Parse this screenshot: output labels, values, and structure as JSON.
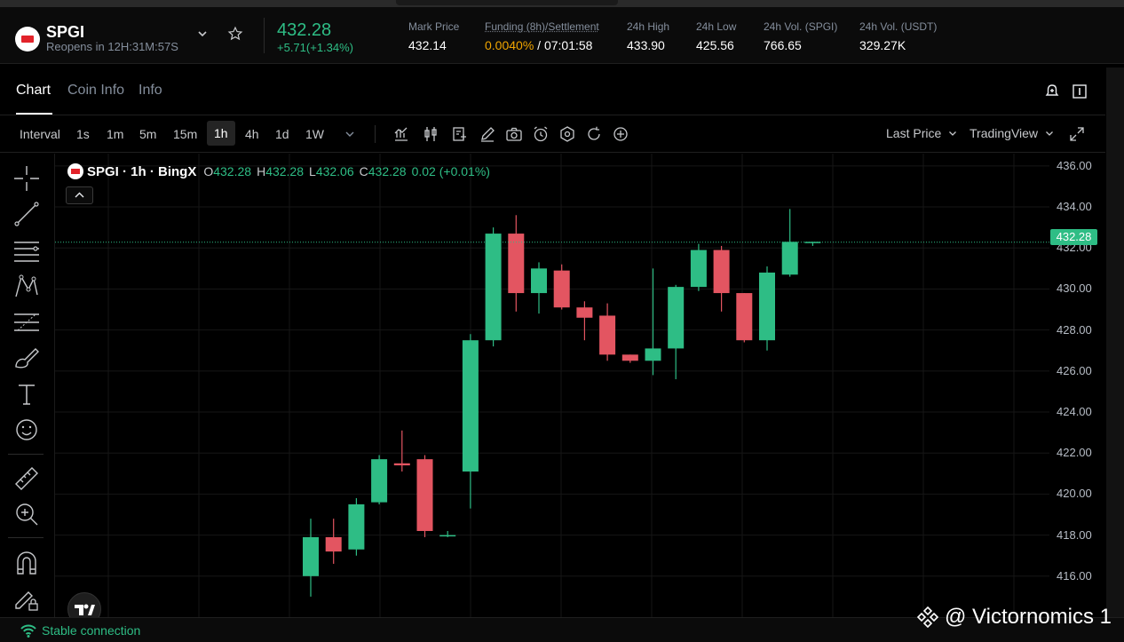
{
  "header": {
    "symbol": "SPGI",
    "reopen_text": "Reopens in  12H:31M:57S",
    "last_price": "432.28",
    "change": "+5.71(+1.34%)",
    "stats": [
      {
        "label": "Mark Price",
        "value": "432.14"
      },
      {
        "label": "Funding (8h)/Settlement",
        "rate": "0.0040%",
        "settle": " / 07:01:58"
      },
      {
        "label": "24h High",
        "value": "433.90"
      },
      {
        "label": "24h Low",
        "value": "425.56"
      },
      {
        "label": "24h Vol. (SPGI)",
        "value": "766.65"
      },
      {
        "label": "24h Vol. (USDT)",
        "value": "329.27K"
      }
    ]
  },
  "tabs": [
    "Chart",
    "Coin Info",
    "Info"
  ],
  "toolbar": {
    "interval_label": "Interval",
    "intervals": [
      "1s",
      "1m",
      "5m",
      "15m",
      "1h",
      "4h",
      "1d",
      "1W"
    ],
    "selected": "1h",
    "price_type": "Last Price",
    "chart_lib": "TradingView"
  },
  "legend": {
    "title": "SPGI · 1h · BingX",
    "o_label": "O",
    "o": "432.28",
    "h_label": "H",
    "h": "432.28",
    "l_label": "L",
    "l": "432.06",
    "c_label": "C",
    "c": "432.28",
    "delta": "0.02 (+0.01%)"
  },
  "status": "Stable connection",
  "watermark": "@ Victornomics 1",
  "colors": {
    "up": "#2ebd85",
    "down": "#e35561",
    "accent": "#f0a500"
  },
  "chart_data": {
    "type": "candlestick",
    "yaxis_ticks": [
      "436.00",
      "434.00",
      "432.00",
      "430.00",
      "428.00",
      "426.00",
      "424.00",
      "422.00",
      "420.00",
      "418.00",
      "416.00"
    ],
    "ylim": [
      414.0,
      436.6
    ],
    "last_price_label": "432.28",
    "candles": [
      {
        "o": 416.0,
        "h": 418.8,
        "l": 415.0,
        "c": 417.9
      },
      {
        "o": 417.9,
        "h": 418.8,
        "l": 416.6,
        "c": 417.2
      },
      {
        "o": 417.3,
        "h": 419.8,
        "l": 417.0,
        "c": 419.5
      },
      {
        "o": 419.6,
        "h": 421.9,
        "l": 419.5,
        "c": 421.7
      },
      {
        "o": 421.5,
        "h": 423.1,
        "l": 421.1,
        "c": 421.4
      },
      {
        "o": 421.7,
        "h": 421.9,
        "l": 417.9,
        "c": 418.2
      },
      {
        "o": 418.0,
        "h": 418.2,
        "l": 417.9,
        "c": 418.0
      },
      {
        "o": 421.1,
        "h": 427.8,
        "l": 419.3,
        "c": 427.5
      },
      {
        "o": 427.5,
        "h": 433.0,
        "l": 427.2,
        "c": 432.7
      },
      {
        "o": 432.7,
        "h": 433.6,
        "l": 428.9,
        "c": 429.8
      },
      {
        "o": 429.8,
        "h": 431.3,
        "l": 428.8,
        "c": 431.0
      },
      {
        "o": 430.9,
        "h": 431.2,
        "l": 429.0,
        "c": 429.1
      },
      {
        "o": 429.1,
        "h": 429.4,
        "l": 427.5,
        "c": 428.6
      },
      {
        "o": 428.7,
        "h": 429.3,
        "l": 426.5,
        "c": 426.8
      },
      {
        "o": 426.8,
        "h": 426.8,
        "l": 426.4,
        "c": 426.5
      },
      {
        "o": 426.5,
        "h": 431.0,
        "l": 425.8,
        "c": 427.1
      },
      {
        "o": 427.1,
        "h": 430.2,
        "l": 425.6,
        "c": 430.1
      },
      {
        "o": 430.1,
        "h": 432.2,
        "l": 429.9,
        "c": 431.9
      },
      {
        "o": 431.9,
        "h": 432.1,
        "l": 428.9,
        "c": 429.8
      },
      {
        "o": 429.8,
        "h": 429.8,
        "l": 427.4,
        "c": 427.5
      },
      {
        "o": 427.5,
        "h": 431.1,
        "l": 427.0,
        "c": 430.8
      },
      {
        "o": 430.7,
        "h": 433.9,
        "l": 430.6,
        "c": 432.3
      },
      {
        "o": 432.3,
        "h": 432.3,
        "l": 432.1,
        "c": 432.3
      }
    ]
  }
}
